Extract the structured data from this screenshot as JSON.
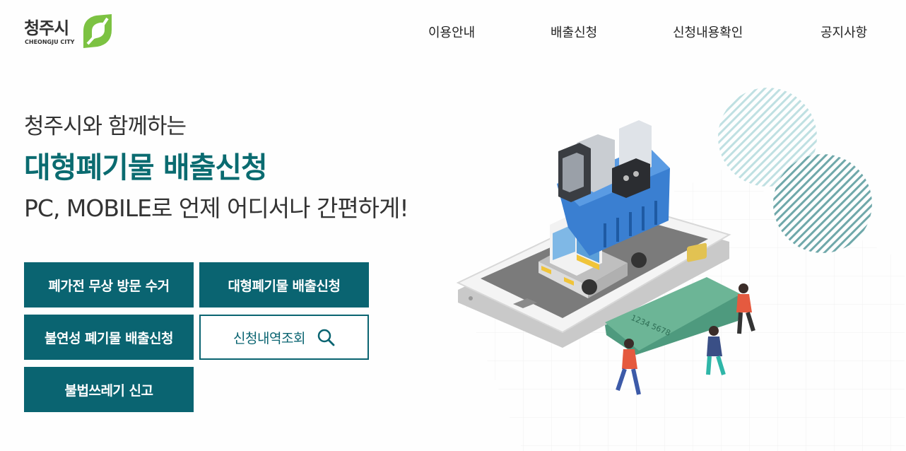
{
  "brand": {
    "name_ko": "청주시",
    "name_en": "CHEONGJU CITY",
    "accent_color": "#0a6471",
    "logo_green": "#7cc242"
  },
  "nav": {
    "items": [
      {
        "label": "이용안내"
      },
      {
        "label": "배출신청"
      },
      {
        "label": "신청내용확인"
      },
      {
        "label": "공지사항"
      }
    ]
  },
  "hero": {
    "subtitle": "청주시와 함께하는",
    "title": "대형폐기물 배출신청",
    "tagline": "PC, MOBILE로 언제 어디서나 간편하게!"
  },
  "buttons": {
    "free_pickup": "폐가전 무상 방문 수거",
    "bulk_apply": "대형폐기물 배출신청",
    "nonflammable_apply": "불연성 폐기물 배출신청",
    "check_history": "신청내역조회",
    "check_history_icon": "search-icon",
    "report_dumping": "불법쓰레기 신고"
  },
  "illustration": {
    "card_number": "1234  5678"
  }
}
